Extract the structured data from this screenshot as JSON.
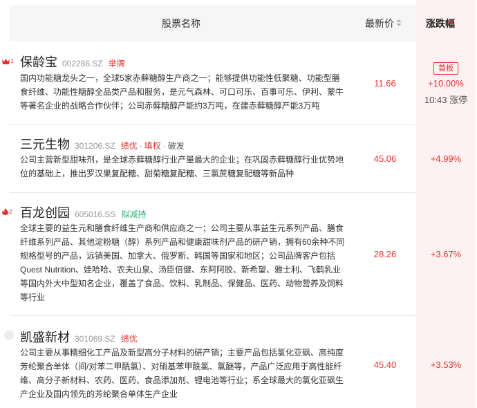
{
  "header": {
    "name_label": "股票名称",
    "price_label": "最新价",
    "change_label": "涨跌幅"
  },
  "colors": {
    "up": "#e93030",
    "tag_green": "#2bb673",
    "highlight_col": "#fdf1f1"
  },
  "rows": [
    {
      "rank": "1",
      "name": "保龄宝",
      "code": "002286.SZ",
      "tags": [
        "举牌"
      ],
      "desc_lines": [
        "国内功能糖龙头之一，全球5家赤藓糖醇生产商之一；能够提供功能性低聚糖、功能型膳",
        "食纤维、功能性糖醇全品类产品和服务，是元气森林、可口可乐、百事可乐、伊利、蒙牛",
        "等著名企业的战略合作伙伴；公司赤藓糖醇产能约3万吨，在建赤藓糖醇产能3万吨"
      ],
      "price": "11.66",
      "change": "+10.00%",
      "badge": "首板",
      "limit": "10:43 涨停"
    },
    {
      "name": "三元生物",
      "code": "301206.SZ",
      "tags": [
        "绩优",
        "·",
        "填权",
        "·",
        "破发"
      ],
      "desc_lines": [
        "公司主营新型甜味剂，是全球赤藓糖醇行业产量最大的企业；在巩固赤藓糖醇行业优势地",
        "位的基础上，推出罗汉果复配糖、甜菊糖复配糖、三氯蔗糖复配糖等新品种"
      ],
      "price": "45.06",
      "change": "+4.99%"
    },
    {
      "rank": "2",
      "name": "百龙创园",
      "code": "605016.SS",
      "tags": [
        "拟减持"
      ],
      "desc_lines": [
        "全球主要的益生元和膳食纤维生产商和供应商之一；公司主要从事益生元系列产品、膳食",
        "纤维系列产品、其他淀粉糖（醇）系列产品和健康甜味剂产品的研产销，拥有60余种不同",
        "规格型号的产品，远销美国、加拿大、俄罗斯、韩国等国家和地区；公司品牌客户包括",
        "Quest Nutrition、娃哈哈、农夫山泉、汤臣倍健、东阿阿胶、新希望、雅士利、飞鹤乳业",
        "等国内外大中型知名企业，覆盖了食品、饮料、乳制品、保健品、医药、动物营养及饲料",
        "等行业"
      ],
      "price": "28.26",
      "change": "+3.67%"
    },
    {
      "name": "凯盛新材",
      "code": "301069.SZ",
      "tags": [
        "绩优"
      ],
      "desc_lines": [
        "公司主要从事精细化工产品及新型高分子材料的研产销；主要产品包括氯化亚砜、高纯度",
        "芳纶聚合单体（间/对苯二甲酰氯）、对硝基苯甲酰氯、氯醚等，产品广泛应用于高性能纤",
        "维、高分子新材料、农药、医药、食品添加剂、锂电池等行业；系全球最大的氯化亚砜生",
        "产企业及国内领先的芳纶聚合单体生产企业"
      ],
      "price": "45.40",
      "change": "+3.53%"
    }
  ]
}
